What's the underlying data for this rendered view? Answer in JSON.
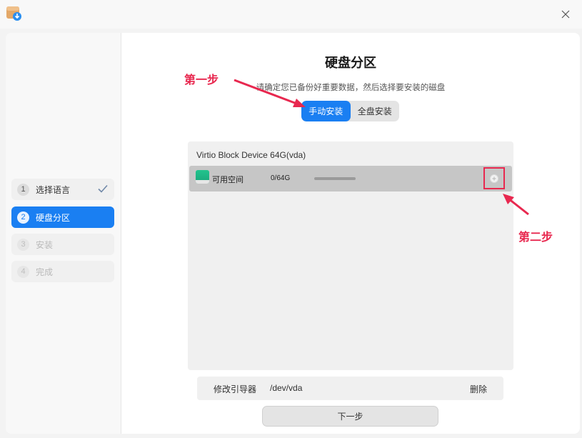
{
  "window": {
    "close_icon": "close-icon",
    "app_icon": "installer-app-icon"
  },
  "sidebar": {
    "steps": [
      {
        "num": "1",
        "label": "选择语言",
        "state": "done"
      },
      {
        "num": "2",
        "label": "硬盘分区",
        "state": "active"
      },
      {
        "num": "3",
        "label": "安装",
        "state": "disabled"
      },
      {
        "num": "4",
        "label": "完成",
        "state": "disabled"
      }
    ]
  },
  "main": {
    "title": "硬盘分区",
    "subtitle": "请确定您已备份好重要数据，然后选择要安装的磁盘",
    "mode_tabs": [
      {
        "label": "手动安装",
        "selected": true
      },
      {
        "label": "全盘安装",
        "selected": false
      }
    ],
    "disk": {
      "name": "Virtio Block Device 64G(vda)",
      "partitions": [
        {
          "label": "可用空间",
          "size": "0/64G"
        }
      ]
    },
    "bootloader": {
      "label": "修改引导器",
      "device": "/dev/vda",
      "delete_label": "删除"
    },
    "next_label": "下一步"
  },
  "annotations": {
    "step1": "第一步",
    "step2": "第二步"
  },
  "colors": {
    "accent": "#1a7ff2",
    "annotation": "#e8284f",
    "partition_green": "#1db584"
  }
}
